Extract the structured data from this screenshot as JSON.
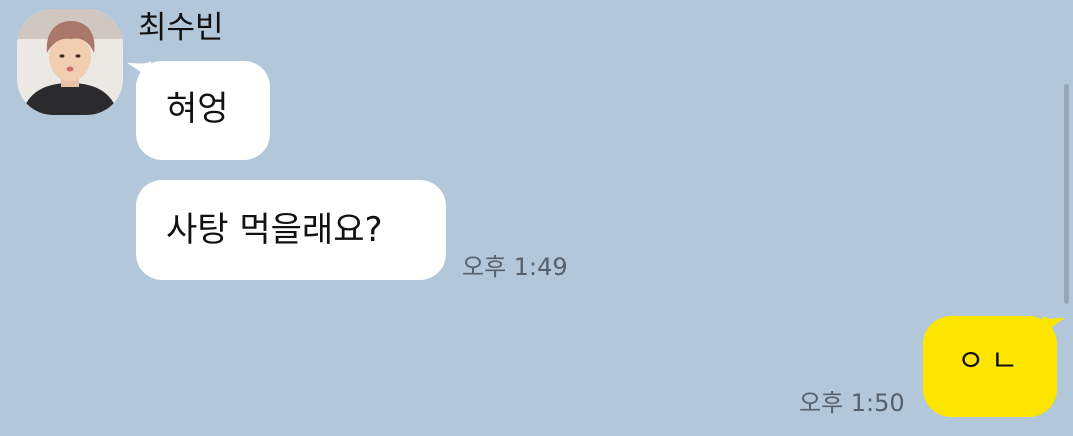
{
  "chat": {
    "sender_name": "최수빈",
    "messages": [
      {
        "from": "other",
        "text": "혀엉"
      },
      {
        "from": "other",
        "text": "사탕 먹을래요?",
        "time": "오후 1:49"
      },
      {
        "from": "me",
        "text": "ㅇㄴ",
        "time": "오후 1:50"
      }
    ]
  },
  "colors": {
    "background": "#b2c7da",
    "incoming_bubble": "#ffffff",
    "outgoing_bubble": "#fee500"
  },
  "icons": {
    "avatar": "profile-photo"
  }
}
